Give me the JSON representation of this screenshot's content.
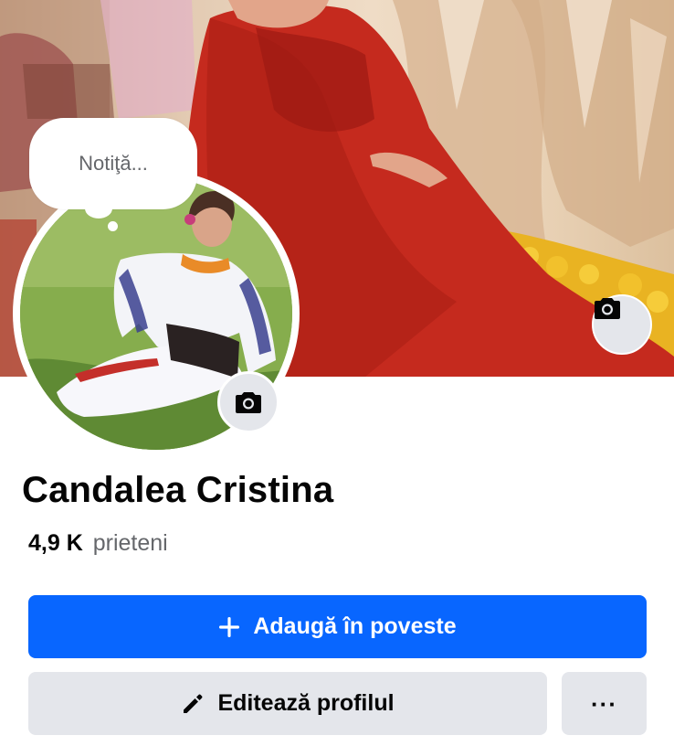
{
  "cover": {
    "camera_icon": "camera-icon"
  },
  "note": {
    "placeholder": "Notiţă..."
  },
  "profile": {
    "name": "Candalea Cristina",
    "friends_count": "4,9 K",
    "friends_label": "prieteni",
    "camera_icon": "camera-icon"
  },
  "actions": {
    "add_story": {
      "label": "Adaugă în poveste",
      "icon": "plus-icon"
    },
    "edit_profile": {
      "label": "Editează profilul",
      "icon": "pencil-icon"
    },
    "more": {
      "label": "···",
      "icon": "more-icon"
    }
  },
  "colors": {
    "primary": "#0866ff",
    "secondary_button": "#e4e6eb",
    "text": "#050505",
    "muted_text": "#65676b"
  }
}
